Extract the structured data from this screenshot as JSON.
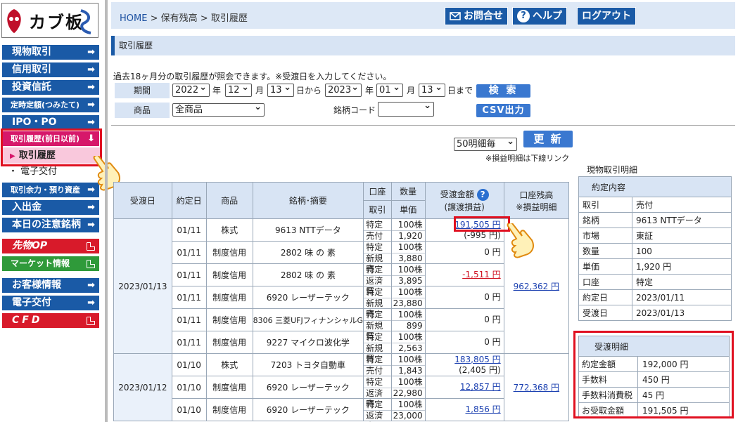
{
  "logo": {
    "text": "カブ板"
  },
  "sidebar": {
    "items": [
      {
        "label": "現物取引"
      },
      {
        "label": "信用取引"
      },
      {
        "label": "投資信託"
      },
      {
        "label": "定時定額(つみたて)"
      },
      {
        "label": "IPO・PO"
      },
      {
        "label": "取引履歴(前日以前)"
      },
      {
        "label": "取引履歴"
      },
      {
        "label": "電子交付"
      },
      {
        "label": "取引余力・預り資産"
      },
      {
        "label": "入出金"
      },
      {
        "label": "本日の注意銘柄"
      },
      {
        "label": "先物OP"
      },
      {
        "label": "マーケット情報"
      },
      {
        "label": "お客様情報"
      },
      {
        "label": "電子交付"
      },
      {
        "label": "CFD"
      }
    ]
  },
  "header": {
    "breadcrumb": [
      "HOME",
      "保有残高",
      "取引履歴"
    ],
    "sep": ">",
    "contact": "お問合せ",
    "help": "ヘルプ",
    "logout": "ログアウト"
  },
  "section_title": "取引履歴",
  "form": {
    "intro": "過去18ヶ月分の取引履歴が照会できます。※受渡日を入力してください。",
    "period_label": "期間",
    "from_year": "2022",
    "from_month": "12",
    "from_day": "13",
    "to_year": "2023",
    "to_month": "01",
    "to_day": "13",
    "year": "年",
    "month": "月",
    "from": "日から",
    "to": "日まで",
    "search": "検 索",
    "product_label": "商品",
    "product": "全商品",
    "code_label": "銘柄コード",
    "code": "",
    "csv": "CSV出力"
  },
  "list": {
    "per_page": "50明細毎",
    "refresh": "更 新",
    "note": "※損益明細は下線リンク"
  },
  "table": {
    "headers": {
      "settle_date": "受渡日",
      "trade_date": "約定日",
      "product": "商品",
      "name": "銘柄･摘要",
      "account": "口座",
      "trade": "取引",
      "qty": "数量",
      "price": "単価",
      "amount": "受渡金額",
      "pl": "(譲渡損益)",
      "balance": "口座残高",
      "balance2": "※損益明細"
    },
    "groups": [
      {
        "date": "2023/01/13",
        "balance": "962,362 円",
        "rows": [
          {
            "d": "01/11",
            "p": "株式",
            "n": "9613 NTTデータ",
            "acct": "特定",
            "tr": "売付",
            "q": "100株",
            "u": "1,920",
            "amt": "191,505 円",
            "pl": "(-995 円)",
            "kind": "lnk"
          },
          {
            "d": "01/11",
            "p": "制度信用",
            "n": "2802 味 の 素",
            "acct": "特定",
            "tr": "新規売",
            "q": "100株",
            "u": "3,880",
            "amt": "0 円",
            "kind": ""
          },
          {
            "d": "01/11",
            "p": "制度信用",
            "n": "2802 味 の 素",
            "acct": "特定",
            "tr": "返済買",
            "q": "100株",
            "u": "3,895",
            "amt": "-1,511 円",
            "kind": "neg"
          },
          {
            "d": "01/11",
            "p": "制度信用",
            "n": "6920 レーザーテック",
            "acct": "特定",
            "tr": "新規売",
            "q": "100株",
            "u": "23,880",
            "amt": "0 円",
            "kind": ""
          },
          {
            "d": "01/11",
            "p": "制度信用",
            "n": "8306 三菱UFJフィナンシャルG",
            "acct": "特定",
            "tr": "新規買",
            "q": "100株",
            "u": "899",
            "amt": "0 円",
            "kind": ""
          },
          {
            "d": "01/11",
            "p": "制度信用",
            "n": "9227 マイクロ波化学",
            "acct": "特定",
            "tr": "新規買",
            "q": "100株",
            "u": "2,563",
            "amt": "0 円",
            "kind": ""
          }
        ]
      },
      {
        "date": "2023/01/12",
        "balance": "772,368 円",
        "rows": [
          {
            "d": "01/10",
            "p": "株式",
            "n": "7203 トヨタ自動車",
            "acct": "特定",
            "tr": "売付",
            "q": "100株",
            "u": "1,843",
            "amt": "183,805 円",
            "pl": "(2,405 円)",
            "kind": "lnk"
          },
          {
            "d": "01/10",
            "p": "制度信用",
            "n": "6920 レーザーテック",
            "acct": "特定",
            "tr": "返済売",
            "q": "100株",
            "u": "22,980",
            "amt": "12,857 円",
            "kind": "lnk"
          },
          {
            "d": "01/10",
            "p": "制度信用",
            "n": "6920 レーザーテック",
            "acct": "特定",
            "tr": "返済売",
            "q": "100株",
            "u": "23,000",
            "amt": "1,856 円",
            "kind": "lnk"
          }
        ]
      }
    ]
  },
  "detail": {
    "title": "現物取引明細",
    "sub": "約定内容",
    "rows": [
      [
        "取引",
        "売付"
      ],
      [
        "銘柄",
        "9613 NTTデータ"
      ],
      [
        "市場",
        "東証"
      ],
      [
        "数量",
        "100"
      ],
      [
        "単価",
        "1,920 円"
      ],
      [
        "口座",
        "特定"
      ],
      [
        "約定日",
        "2023/01/11"
      ],
      [
        "受渡日",
        "2023/01/13"
      ]
    ],
    "settle_title": "受渡明細",
    "settle_rows": [
      [
        "約定金額",
        "192,000 円"
      ],
      [
        "手数料",
        "450 円"
      ],
      [
        "手数料消費税",
        "45 円"
      ],
      [
        "お受取金額",
        "191,505 円"
      ]
    ]
  },
  "colors": {
    "nav_blue": "#1a5aa6",
    "pink": "#d6186a",
    "highlight": "#e01020",
    "header_bg": "#d8e4f4"
  }
}
